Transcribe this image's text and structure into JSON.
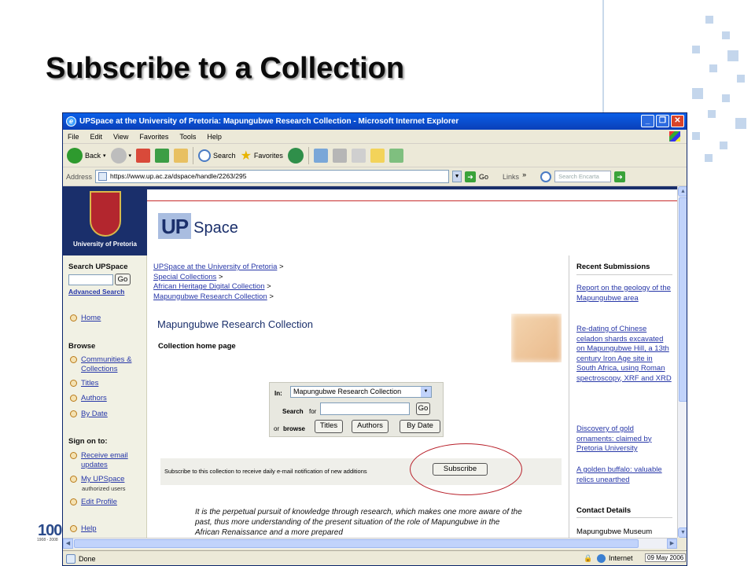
{
  "slide": {
    "title": "Subscribe to a Collection",
    "logo_text": "100",
    "logo_sub": "1908 - 2008"
  },
  "browser": {
    "window_title": "UPSpace at the University of Pretoria: Mapungubwe Research Collection - Microsoft Internet Explorer",
    "menu": [
      "File",
      "Edit",
      "View",
      "Favorites",
      "Tools",
      "Help"
    ],
    "toolbar": {
      "back": "Back",
      "search": "Search",
      "favorites": "Favorites"
    },
    "address_label": "Address",
    "url": "https://www.up.ac.za/dspace/handle/2263/295",
    "go_label": "Go",
    "links_label": "Links",
    "links_chevron": "»",
    "search_placeholder": "Search Encarta",
    "status_left": "Done",
    "status_zone": "Internet",
    "clock_date": "09 May 2006"
  },
  "page": {
    "university_name": "University of Pretoria",
    "brand_up": "UP",
    "brand_space": "Space",
    "left_nav": {
      "search_heading": "Search UPSpace",
      "go_button": "Go",
      "advanced_search": "Advanced Search",
      "home": "Home",
      "browse_heading": "Browse",
      "communities": "Communities & Collections",
      "titles": "Titles",
      "authors": "Authors",
      "by_date": "By Date",
      "signon_heading": "Sign on to:",
      "receive_email": "Receive email updates",
      "my_upspace": "My UPSpace",
      "authorized_users": "authorized users",
      "edit_profile": "Edit Profile",
      "help": "Help"
    },
    "breadcrumbs": [
      {
        "label": "UPSpace at the University of Pretoria",
        "sep": ">"
      },
      {
        "label": "Special Collections",
        "sep": ">"
      },
      {
        "label": "African Heritage Digital Collection",
        "sep": ">"
      },
      {
        "label": "Mapungubwe Research Collection",
        "sep": ">"
      }
    ],
    "collection_title": "Mapungubwe Research Collection",
    "collection_subtitle": "Collection home page",
    "search_panel": {
      "in_label": "In:",
      "scope_value": "Mapungubwe Research Collection",
      "search_label": "Search",
      "for_label": "for",
      "go_button": "Go",
      "or_label": "or",
      "browse_label": "browse",
      "titles_button": "Titles",
      "authors_button": "Authors",
      "by_date_button": "By Date"
    },
    "subscribe": {
      "text": "Subscribe to this collection to receive daily e-mail notification of new additions",
      "button": "Subscribe"
    },
    "quote": "It is the perpetual pursuit of knowledge through research, which makes one more aware of the past, thus more understanding of the present situation of the role of Mapungubwe in the African Renaissance and a more prepared",
    "right_col": {
      "recent_heading": "Recent Submissions",
      "items": [
        "Report on the geology of the Mapungubwe area",
        "Re-dating of Chinese celadon shards excavated on Mapungubwe Hill, a 13th century Iron Age site in South Africa, using Roman spectroscopy, XRF and XRD",
        "Discovery of gold ornaments: claimed by Pretoria University",
        "A golden buffalo: valuable relics unearthed"
      ],
      "contact_heading": "Contact Details",
      "contact_line": "Mapungubwe Museum"
    }
  }
}
